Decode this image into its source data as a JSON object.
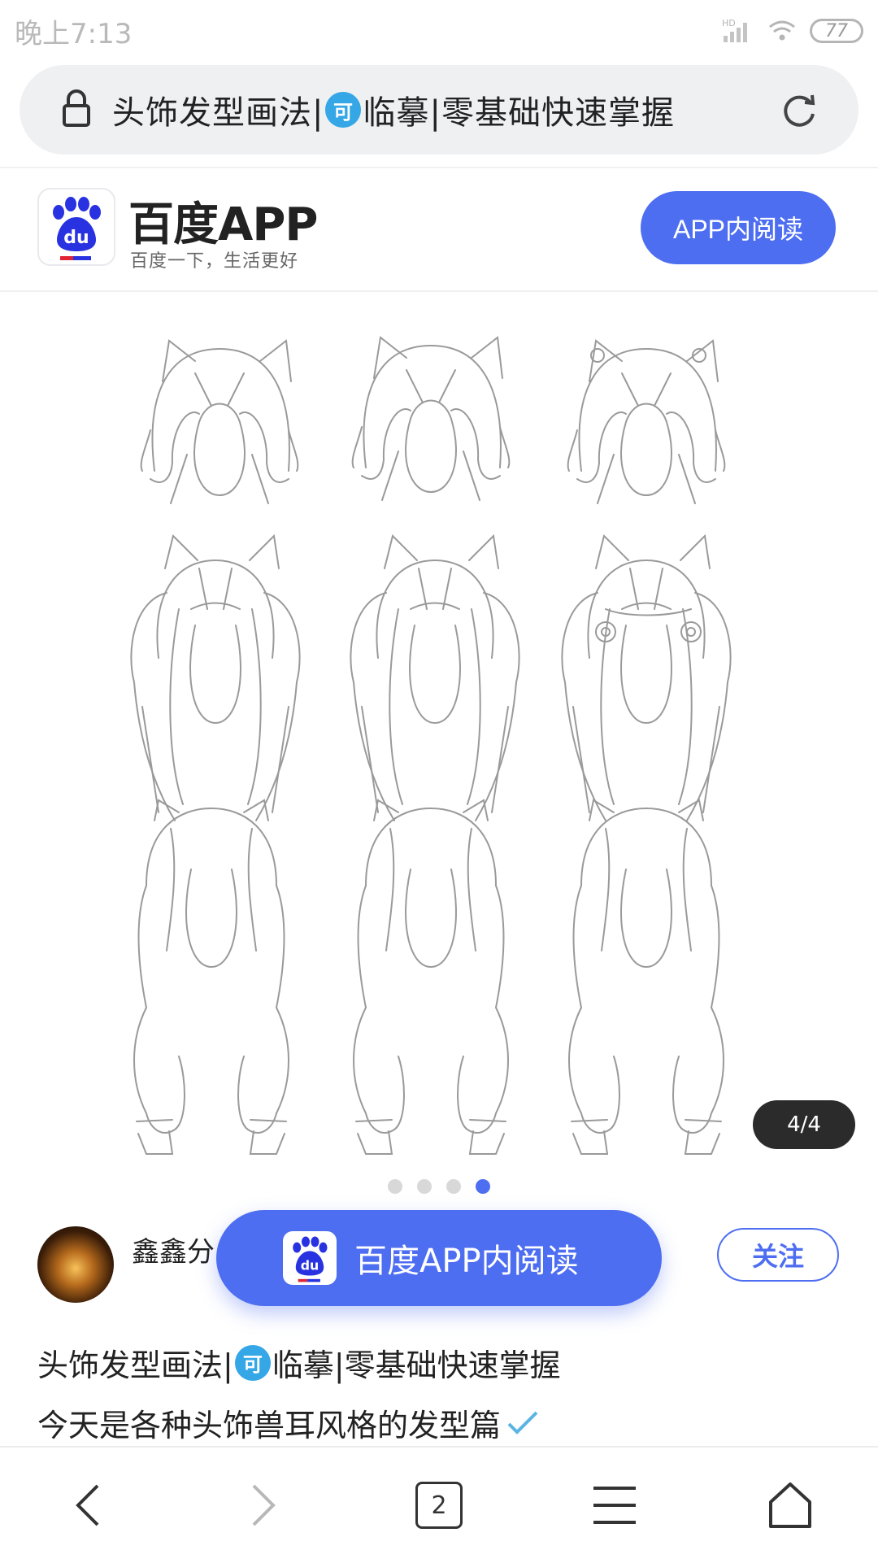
{
  "status": {
    "time": "晚上7:13",
    "battery": "77",
    "hd": "HD"
  },
  "address_bar": {
    "title_pre": "头饰发型画法|",
    "badge": "可",
    "title_post": "临摹|零基础快速掌握"
  },
  "app_banner": {
    "logo_text": "du",
    "name": "百度APP",
    "slogan": "百度一下，生活更好",
    "read_button": "APP内阅读"
  },
  "gallery": {
    "page_counter": "4/4",
    "total_pages": 4,
    "current_page": 4
  },
  "author": {
    "name": "鑫鑫分",
    "follow_label": "关注"
  },
  "floating_cta": {
    "label": "百度APP内阅读"
  },
  "post": {
    "title_pre": "头饰发型画法|",
    "title_badge": "可",
    "title_post": "临摹|零基础快速掌握",
    "description": "今天是各种头饰兽耳风格的发型篇"
  },
  "bottom_nav": {
    "tabs_count": "2",
    "items": [
      "back-icon",
      "forward-icon",
      "tabs-icon",
      "menu-icon",
      "home-icon"
    ]
  },
  "colors": {
    "accent": "#4e6ef2",
    "badge": "#35a6e6",
    "baidu_red": "#e02433"
  }
}
